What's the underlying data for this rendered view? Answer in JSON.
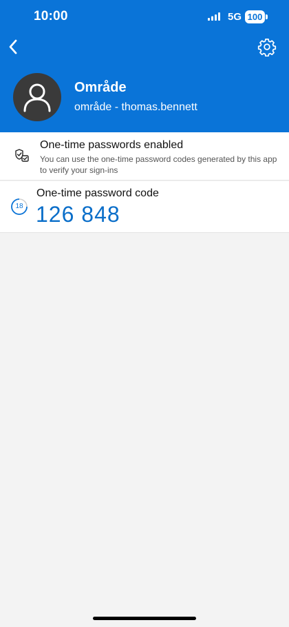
{
  "status_bar": {
    "time": "10:00",
    "network": "5G",
    "battery": "100"
  },
  "header": {
    "back_icon": "chevron-left-icon",
    "settings_icon": "gear-icon",
    "account_name": "Område",
    "account_detail": "område - thomas.bennett",
    "avatar_icon": "person-icon"
  },
  "otp_enabled": {
    "icon": "shield-check-icon",
    "title": "One-time passwords enabled",
    "description": "You can use the one-time password codes generated by this app to verify your sign-ins"
  },
  "otp_code": {
    "timer_seconds": "18",
    "label": "One-time password code",
    "code": "126 848"
  },
  "colors": {
    "brand_blue": "#0a74d8",
    "code_blue": "#0a6ec9",
    "background": "#f3f3f3"
  }
}
